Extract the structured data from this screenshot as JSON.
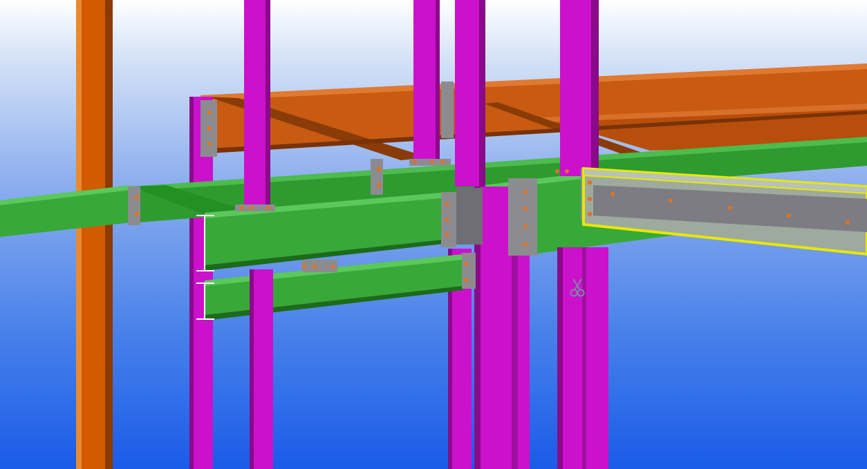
{
  "viewport": {
    "view_name": "",
    "cursor_icon": "scissors-icon",
    "dimension_icon": "dimension-marker-icon",
    "colors": {
      "column": "#cc11cc",
      "column_shade": "#8a0a8a",
      "pipe_column": "#d25a00",
      "pipe_column_shade": "#8c3a00",
      "upper_beam": "#c85a12",
      "upper_beam_shade": "#7a3206",
      "lower_beam": "#38a838",
      "lower_beam_shade": "#1d6a1d",
      "connection_plate": "#8c8c90",
      "bolt": "#d8732a",
      "selected_outline": "#e8e800"
    }
  }
}
